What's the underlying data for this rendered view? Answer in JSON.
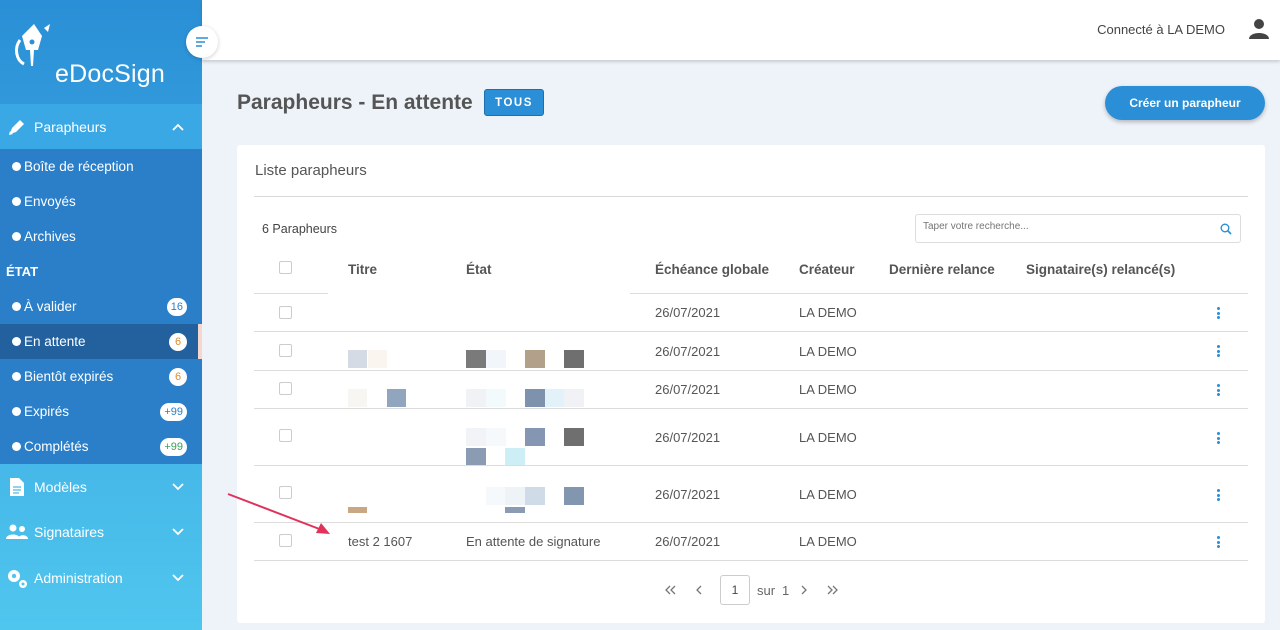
{
  "app": {
    "brand": "eDocSign"
  },
  "sidebar": {
    "parapheurs_label": "Parapheurs",
    "items": [
      {
        "label": "Boîte de réception"
      },
      {
        "label": "Envoyés"
      },
      {
        "label": "Archives"
      }
    ],
    "etat_label": "ÉTAT",
    "states": [
      {
        "label": "À valider",
        "badge": "16",
        "badge_color": "#2b7fc9"
      },
      {
        "label": "En attente",
        "badge": "6",
        "badge_color": "#e08a2b"
      },
      {
        "label": "Bientôt expirés",
        "badge": "6",
        "badge_color": "#e08a2b"
      },
      {
        "label": "Expirés",
        "badge": "+99",
        "badge_color": "#2b7fc9"
      },
      {
        "label": "Complétés",
        "badge": "+99",
        "badge_color": "#3aa05a"
      }
    ],
    "modeles_label": "Modèles",
    "signataires_label": "Signataires",
    "administration_label": "Administration"
  },
  "topbar": {
    "connected_label": "Connecté à LA DEMO"
  },
  "page": {
    "title": "Parapheurs - En attente",
    "filter_tag": "TOUS",
    "create_button": "Créer un parapheur"
  },
  "card": {
    "title": "Liste parapheurs",
    "count": "6 Parapheurs",
    "search_placeholder": "Taper votre recherche...",
    "columns": [
      "Titre",
      "État",
      "Échéance globale",
      "Créateur",
      "Dernière relance",
      "Signataire(s) relancé(s)"
    ],
    "rows": [
      {
        "titre": "",
        "etat": "",
        "echeance": "26/07/2021",
        "createur": "LA DEMO"
      },
      {
        "titre": "",
        "etat": "",
        "echeance": "26/07/2021",
        "createur": "LA DEMO"
      },
      {
        "titre": "",
        "etat": "",
        "echeance": "26/07/2021",
        "createur": "LA DEMO"
      },
      {
        "titre": "",
        "etat": "",
        "echeance": "26/07/2021",
        "createur": "LA DEMO"
      },
      {
        "titre": "",
        "etat": "",
        "echeance": "26/07/2021",
        "createur": "LA DEMO"
      },
      {
        "titre": "test 2 1607",
        "etat": "En attente de signature",
        "echeance": "26/07/2021",
        "createur": "LA DEMO"
      }
    ]
  },
  "pagination": {
    "current_page": "1",
    "of_label": "sur",
    "total_pages": "1"
  },
  "colors": {
    "accent": "#2a8fd6",
    "annotation_arrow": "#e0325a"
  }
}
